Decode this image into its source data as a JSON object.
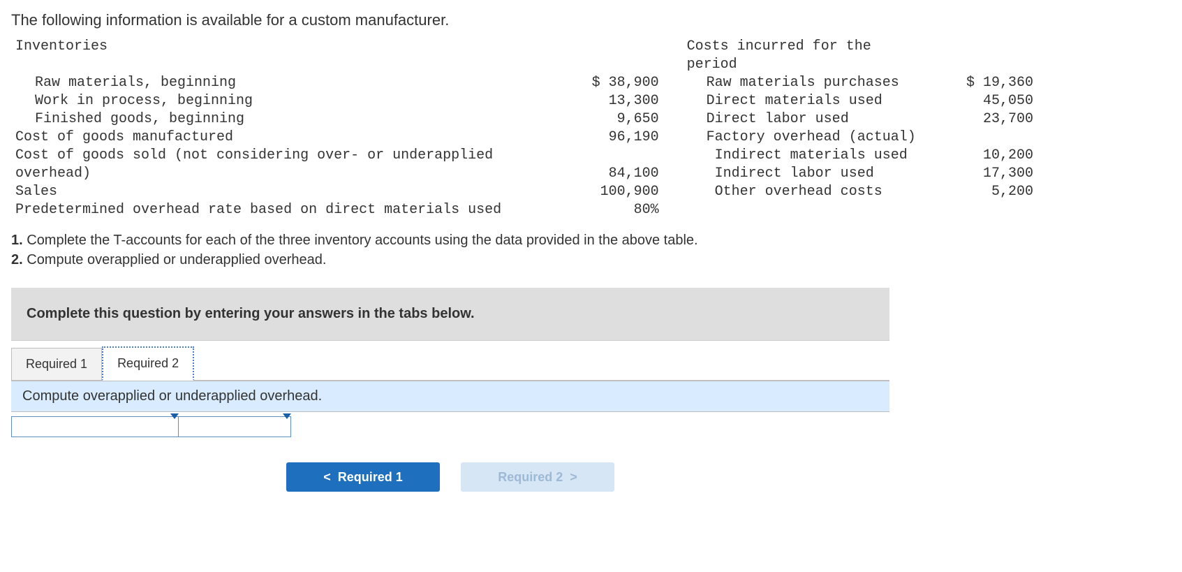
{
  "intro": "The following information is available for a custom manufacturer.",
  "left": {
    "header": "Inventories",
    "rows": [
      {
        "label": "Raw materials, beginning",
        "value": "$ 38,900",
        "indent": true
      },
      {
        "label": "Work in process, beginning",
        "value": "13,300",
        "indent": true
      },
      {
        "label": "Finished goods, beginning",
        "value": "9,650",
        "indent": true
      },
      {
        "label": "Cost of goods manufactured",
        "value": "96,190",
        "indent": false
      },
      {
        "label": "Cost of goods sold (not considering over- or underapplied overhead)",
        "value": "84,100",
        "indent": false
      },
      {
        "label": "Sales",
        "value": "100,900",
        "indent": false
      },
      {
        "label": "Predetermined overhead rate based on direct materials used",
        "value": "80%",
        "indent": false
      }
    ]
  },
  "right": {
    "header": "Costs incurred for the period",
    "rows": [
      {
        "label": "Raw materials purchases",
        "value": "$ 19,360",
        "indent": true
      },
      {
        "label": "Direct materials used",
        "value": "45,050",
        "indent": true
      },
      {
        "label": "Direct labor used",
        "value": "23,700",
        "indent": true
      },
      {
        "label": "Factory overhead (actual)",
        "value": "",
        "indent": true
      },
      {
        "label": "Indirect materials used",
        "value": "10,200",
        "indent2": true
      },
      {
        "label": "Indirect labor used",
        "value": "17,300",
        "indent2": true
      },
      {
        "label": "Other overhead costs",
        "value": "5,200",
        "indent2": true
      }
    ]
  },
  "questions": {
    "q1_num": "1.",
    "q1_text": " Complete the T-accounts for each of the three inventory accounts using the data provided in the above table.",
    "q2_num": "2.",
    "q2_text": " Compute overapplied or underapplied overhead."
  },
  "instruction": "Complete this question by entering your answers in the tabs below.",
  "tabs": {
    "tab1": "Required 1",
    "tab2": "Required 2"
  },
  "subprompt": "Compute overapplied or underapplied overhead.",
  "nav": {
    "prev": "Required 1",
    "next": "Required 2",
    "prev_chev": "<",
    "next_chev": ">"
  }
}
